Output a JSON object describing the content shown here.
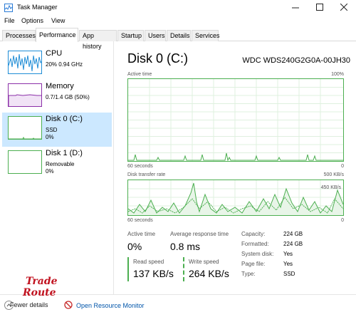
{
  "window": {
    "title": "Task Manager"
  },
  "menu": [
    {
      "label": "File"
    },
    {
      "label": "Options"
    },
    {
      "label": "View"
    }
  ],
  "tabs": [
    {
      "label": "Processes"
    },
    {
      "label": "Performance"
    },
    {
      "label": "App history"
    },
    {
      "label": "Startup"
    },
    {
      "label": "Users"
    },
    {
      "label": "Details"
    },
    {
      "label": "Services"
    }
  ],
  "sidebar": {
    "cpu": {
      "name": "CPU",
      "sub1": "20% 0.94 GHz",
      "sub2": ""
    },
    "memory": {
      "name": "Memory",
      "sub1": "0.7/1.4 GB (50%)",
      "sub2": ""
    },
    "disk0": {
      "name": "Disk 0 (C:)",
      "sub1": "SSD",
      "sub2": "0%"
    },
    "disk1": {
      "name": "Disk 1 (D:)",
      "sub1": "Removable",
      "sub2": "0%"
    }
  },
  "main": {
    "title": "Disk 0 (C:)",
    "model": "WDC WDS240G2G0A-00JH30",
    "graph1": {
      "label": "Active time",
      "max": "100%",
      "time": "60 seconds",
      "zero": "0"
    },
    "graph2": {
      "label": "Disk transfer rate",
      "max": "500 KB/s",
      "mid": "450 KB/s",
      "time": "60 seconds",
      "zero": "0"
    }
  },
  "stats": {
    "active_time": {
      "label": "Active time",
      "value": "0%"
    },
    "avg_response": {
      "label": "Average response time",
      "value": "0.8 ms"
    },
    "read_speed": {
      "label": "Read speed",
      "value": "137 KB/s"
    },
    "write_speed": {
      "label": "Write speed",
      "value": "264 KB/s"
    }
  },
  "properties": [
    {
      "label": "Capacity:",
      "value": "224 GB"
    },
    {
      "label": "Formatted:",
      "value": "224 GB"
    },
    {
      "label": "System disk:",
      "value": "Yes"
    },
    {
      "label": "Page file:",
      "value": "Yes"
    },
    {
      "label": "Type:",
      "value": "SSD"
    }
  ],
  "bottom": {
    "fewer_details": "Fewer details",
    "open_resource_monitor": "Open Resource Monitor"
  },
  "watermark": {
    "line1": "Trade",
    "line2": "Route"
  },
  "colors": {
    "disk_accent": "#4caf50",
    "cpu_accent": "#1f8dd6",
    "memory_accent": "#8b2fa8",
    "selected_bg": "#cce8ff"
  }
}
